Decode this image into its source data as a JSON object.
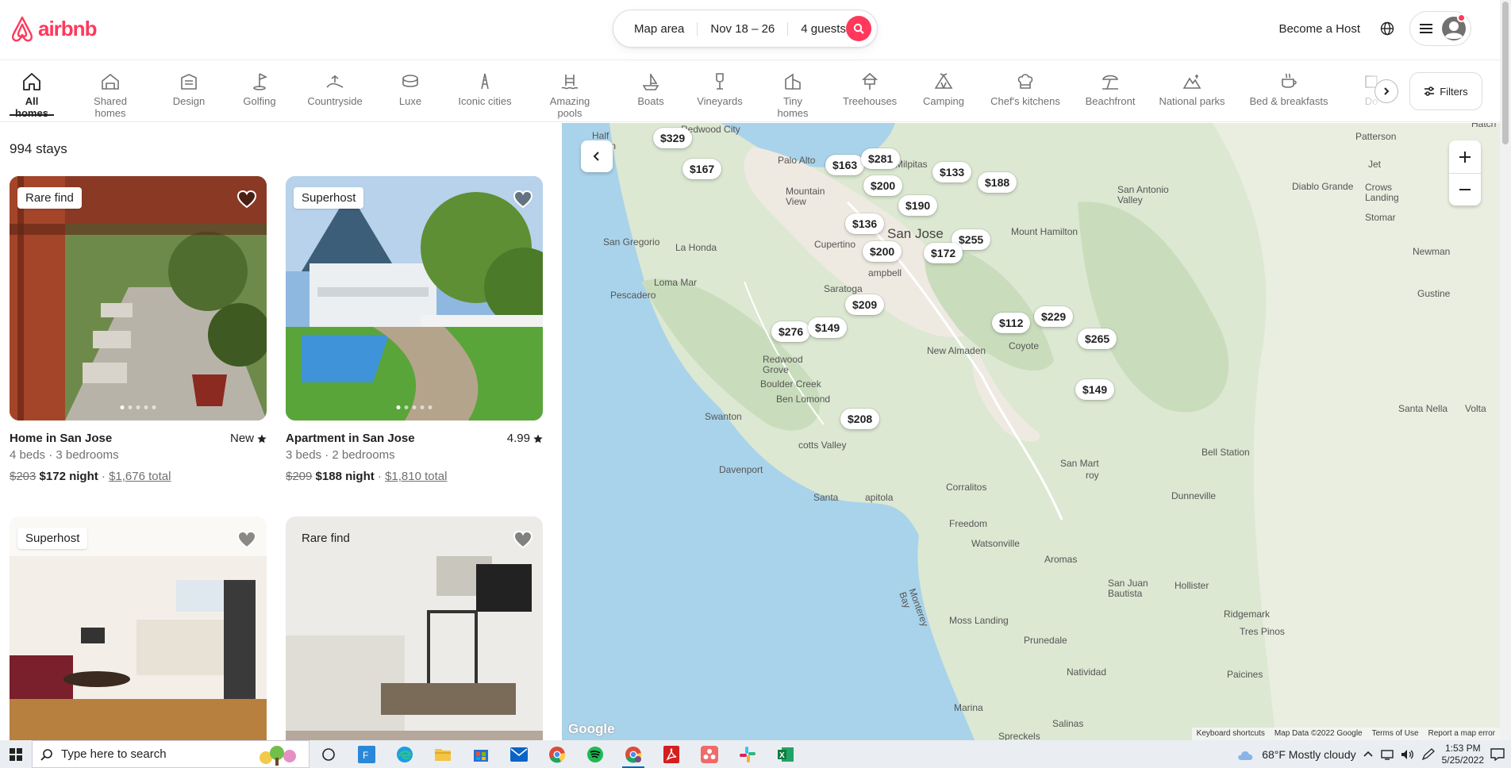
{
  "brand": {
    "name": "airbnb",
    "color": "#ff385c"
  },
  "search": {
    "location": "Map area",
    "dates": "Nov 18 – 26",
    "guests": "4 guests"
  },
  "header": {
    "become_host": "Become a Host"
  },
  "categories": [
    {
      "label": "All homes",
      "icon": "house-icon",
      "active": true
    },
    {
      "label": "Shared homes",
      "icon": "shared-home-icon"
    },
    {
      "label": "Design",
      "icon": "design-building-icon"
    },
    {
      "label": "Golfing",
      "icon": "golf-flag-icon"
    },
    {
      "label": "Countryside",
      "icon": "countryside-icon"
    },
    {
      "label": "Luxe",
      "icon": "luxe-icon"
    },
    {
      "label": "Iconic cities",
      "icon": "iconic-city-icon"
    },
    {
      "label": "Amazing pools",
      "icon": "pool-icon"
    },
    {
      "label": "Boats",
      "icon": "boat-icon"
    },
    {
      "label": "Vineyards",
      "icon": "vineyard-icon"
    },
    {
      "label": "Tiny homes",
      "icon": "tiny-home-icon"
    },
    {
      "label": "Treehouses",
      "icon": "treehouse-icon"
    },
    {
      "label": "Camping",
      "icon": "tent-icon"
    },
    {
      "label": "Chef's kitchens",
      "icon": "chef-hat-icon"
    },
    {
      "label": "Beachfront",
      "icon": "beach-icon"
    },
    {
      "label": "National parks",
      "icon": "national-park-icon"
    },
    {
      "label": "Bed & breakfasts",
      "icon": "coffee-icon"
    },
    {
      "label": "Do",
      "icon": "partial-category-icon"
    }
  ],
  "filters_label": "Filters",
  "results": {
    "count_label": "994 stays"
  },
  "listings": [
    {
      "badge": "Rare find",
      "title": "Home in San Jose",
      "rating": "New",
      "beds": "4 beds · 3 bedrooms",
      "old_price": "$203",
      "price": "$172 night",
      "sep": " · ",
      "total": "$1,676 total"
    },
    {
      "badge": "Superhost",
      "title": "Apartment in San Jose",
      "rating": "4.99",
      "beds": "3 beds · 2 bedrooms",
      "old_price": "$209",
      "price": "$188 night",
      "sep": " · ",
      "total": "$1,810 total"
    },
    {
      "badge": "Superhost"
    },
    {
      "badge": "Rare find"
    }
  ],
  "map": {
    "places": {
      "redwood_city": "Redwood City",
      "half_moon_bay": "Half\nMoon\nBay",
      "palo_alto": "Palo Alto",
      "milpitas": "Milpitas",
      "mountain_view": "Mountain\nView",
      "san_jose": "San Jose",
      "cupertino": "Cupertino",
      "campbell": "ampbell",
      "san_gregorio": "San Gregorio",
      "la_honda": "La Honda",
      "loma_mar": "Loma Mar",
      "pescadero": "Pescadero",
      "saratoga": "Saratoga",
      "los_gatos": "Lo",
      "new_almaden": "New Almaden",
      "coyote": "Coyote",
      "redwood_grove": "Redwood\nGrove",
      "boulder_creek": "Boulder Creek",
      "ben_lomond": "Ben Lomond",
      "swanton": "Swanton",
      "scotts_valley": "cotts Valley",
      "davenport": "Davenport",
      "santa_cruz": "Santa",
      "capitola": "apitola",
      "corralitos": "Corralitos",
      "freedom": "Freedom",
      "watsonville": "Watsonville",
      "aromas": "Aromas",
      "san_juan_bautista": "San Juan\nBautista",
      "hollister": "Hollister",
      "ridgemark": "Ridgemark",
      "tres_pinos": "Tres Pinos",
      "moss_landing": "Moss Landing",
      "prunedale": "Prunedale",
      "paicines": "Paicines",
      "natividad": "Natividad",
      "marina": "Marina",
      "salinas": "Salinas",
      "spreckels": "Spreckels",
      "monterey_bay": "Monterey\nBay",
      "san_martin": "San Mart",
      "gilroy": "roy",
      "dunneville": "Dunneville",
      "bell_station": "Bell Station",
      "santa_nella": "Santa Nella",
      "volta": "Volta",
      "gustine": "Gustine",
      "newman": "Newman",
      "stomar": "Stomar",
      "crows_landing": "Crows\nLanding",
      "diablo_grande": "Diablo Grande",
      "patterson": "Patterson",
      "jet": "Jet",
      "hatch": "Hatch",
      "san_antonio_valley": "San Antonio\nValley",
      "mount_hamilton": "Mount Hamilton"
    },
    "pins": [
      "$329",
      "$167",
      "$163",
      "$281",
      "$133",
      "$188",
      "$200",
      "$190",
      "$136",
      "$255",
      "$200",
      "$172",
      "$209",
      "$229",
      "$112",
      "$276",
      "$149",
      "$265",
      "$149",
      "$208"
    ],
    "google": "Google",
    "attribution": [
      "Keyboard shortcuts",
      "Map Data ©2022 Google",
      "Terms of Use",
      "Report a map error"
    ]
  },
  "taskbar": {
    "search_placeholder": "Type here to search",
    "weather": "68°F  Mostly cloudy",
    "time": "1:53 PM",
    "date": "5/25/2022",
    "apps": [
      "task-view-icon",
      "files-app-icon",
      "edge-icon",
      "file-explorer-icon",
      "store-icon",
      "mail-icon",
      "chrome-icon",
      "spotify-icon",
      "chrome-profile-icon",
      "acrobat-icon",
      "asana-icon",
      "slack-icon",
      "excel-icon"
    ]
  }
}
